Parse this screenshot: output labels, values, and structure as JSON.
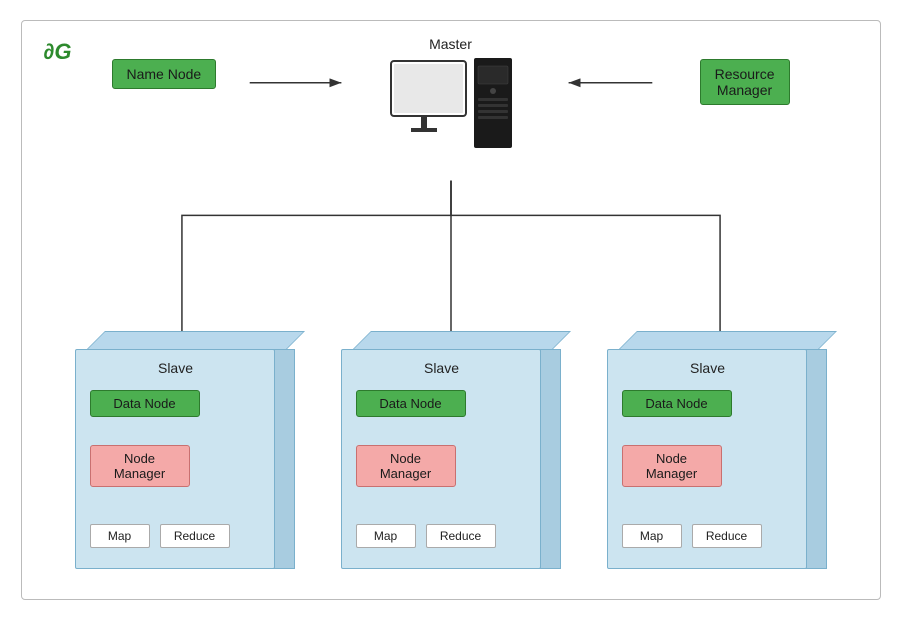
{
  "logo": {
    "text": "∂G"
  },
  "master": {
    "label": "Master",
    "name_node": "Name Node",
    "resource_manager_line1": "Resource",
    "resource_manager_line2": "Manager",
    "resource_manager": "Resource Manager"
  },
  "slaves": [
    {
      "label": "Slave",
      "data_node": "Data Node",
      "node_manager_line1": "Node",
      "node_manager_line2": "Manager",
      "map": "Map",
      "reduce": "Reduce"
    },
    {
      "label": "Slave",
      "data_node": "Data Node",
      "node_manager_line1": "Node",
      "node_manager_line2": "Manager",
      "map": "Map",
      "reduce": "Reduce"
    },
    {
      "label": "Slave",
      "data_node": "Data Node",
      "node_manager_line1": "Node",
      "node_manager_line2": "Manager",
      "map": "Map",
      "reduce": "Reduce"
    }
  ],
  "colors": {
    "green_box": "#4caf50",
    "red_box": "#f4a9a8",
    "slave_front": "#cce4f0",
    "slave_right": "#a8cce0",
    "slave_top": "#b8d8ec"
  }
}
